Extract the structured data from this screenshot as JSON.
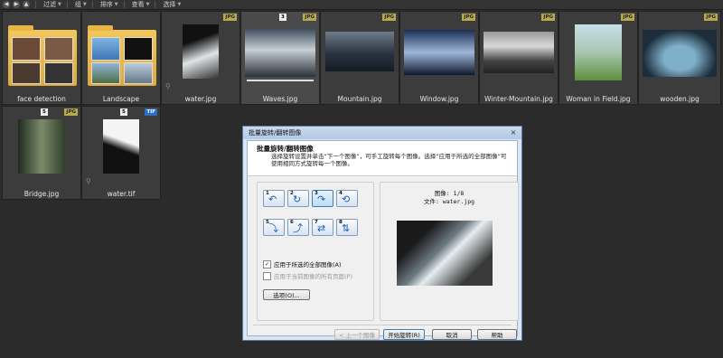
{
  "toolbar": {
    "items": [
      {
        "label": "过滤"
      },
      {
        "label": "组"
      },
      {
        "label": "排序"
      },
      {
        "label": "查看"
      },
      {
        "label": "选择"
      }
    ]
  },
  "thumbnails": [
    {
      "caption": "face detection",
      "badge": "",
      "kind": "folder"
    },
    {
      "caption": "Landscape",
      "badge": "",
      "kind": "folder"
    },
    {
      "caption": "water.jpg",
      "badge": "JPG",
      "kind": "image",
      "colors": [
        "#222",
        "#dfe4e6"
      ]
    },
    {
      "caption": "Waves.jpg",
      "badge": "JPG",
      "number": "3",
      "kind": "image",
      "colors": [
        "#42505c",
        "#c6ced4"
      ]
    },
    {
      "caption": "Mountain.jpg",
      "badge": "JPG",
      "kind": "image",
      "colors": [
        "#2a3340",
        "#6f7b8a"
      ]
    },
    {
      "caption": "Window.jpg",
      "badge": "JPG",
      "kind": "image",
      "colors": [
        "#1a2e55",
        "#9fb8d8"
      ]
    },
    {
      "caption": "Winter-Mountain.jpg",
      "badge": "JPG",
      "kind": "image",
      "colors": [
        "#555",
        "#d9d9d9"
      ]
    },
    {
      "caption": "Woman in Field.jpg",
      "badge": "JPG",
      "kind": "image",
      "colors": [
        "#5c8f3a",
        "#c7dfe8"
      ]
    },
    {
      "caption": "wooden.jpg",
      "badge": "JPG",
      "kind": "image",
      "colors": [
        "#1c2e3c",
        "#7fb0c9"
      ]
    },
    {
      "caption": "Bridge.jpg",
      "badge": "JPG",
      "number": "5",
      "kind": "image",
      "colors": [
        "#2f3f2a",
        "#7d8a6c"
      ]
    },
    {
      "caption": "water.tif",
      "badge": "TIF",
      "number": "5",
      "kind": "image",
      "colors": [
        "#111",
        "#f4f4f4"
      ]
    }
  ],
  "dialog": {
    "title": "批量旋转/翻转图像",
    "close": "×",
    "heading": "批量旋转/翻转图像",
    "description": "选择旋转设置并单击“下一个图像”，可手工旋转每个图像。选择“应用于所选的全部图像”可使用相同方式旋转每一个图像。",
    "rotate_buttons": [
      {
        "num": "1",
        "icon": "↶"
      },
      {
        "num": "2",
        "icon": "↻"
      },
      {
        "num": "3",
        "icon": "↷"
      },
      {
        "num": "4",
        "icon": "⟲"
      },
      {
        "num": "5",
        "icon": "⤵"
      },
      {
        "num": "6",
        "icon": "⤴"
      },
      {
        "num": "7",
        "icon": "⇄"
      },
      {
        "num": "8",
        "icon": "⇅"
      }
    ],
    "apply_all_label": "应用于所选的全部图像(A)",
    "apply_pages_label": "应用于当前图像的所有页面(P)",
    "options_button": "选项(O)...",
    "preview_counter": "图像: 1/8",
    "preview_file": "文件: water.jpg",
    "prev_button": "< 上一个图像",
    "start_button": "开始旋转(R)",
    "cancel_button": "取消",
    "help_button": "帮助"
  }
}
